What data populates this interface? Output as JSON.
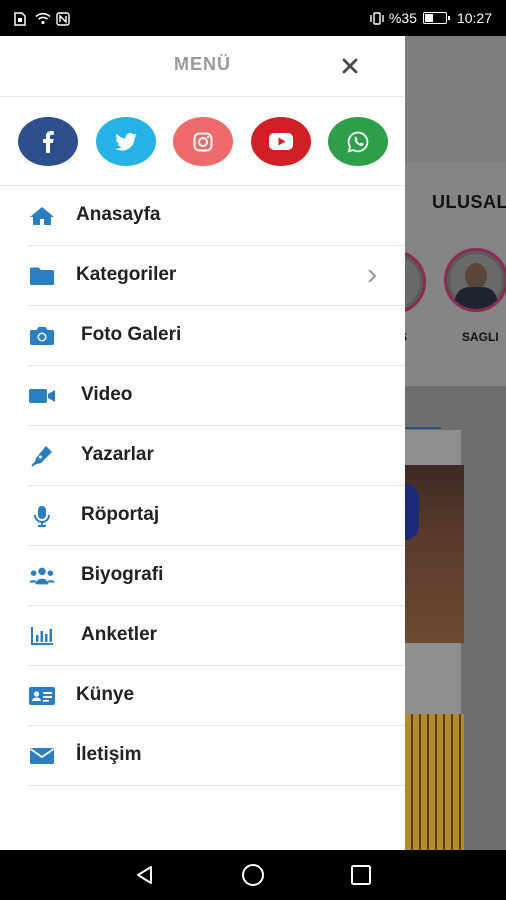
{
  "status": {
    "battery_percent": "%35",
    "time": "10:27",
    "battery_level": 0.35
  },
  "background": {
    "tab_label": "ULUSAL",
    "stories": [
      {
        "label": "S"
      },
      {
        "label": "SAGLI"
      }
    ]
  },
  "drawer": {
    "title": "MENÜ",
    "social": [
      {
        "icon": "facebook-icon",
        "color": "#2d4f8b"
      },
      {
        "icon": "twitter-icon",
        "color": "#27b2e6"
      },
      {
        "icon": "instagram-icon",
        "color": "#ef6a6a"
      },
      {
        "icon": "youtube-icon",
        "color": "#d11f26"
      },
      {
        "icon": "whatsapp-icon",
        "color": "#2f9e4a"
      }
    ],
    "items": [
      {
        "label": "Anasayfa",
        "icon": "home-icon"
      },
      {
        "label": "Kategoriler",
        "icon": "folder-icon"
      },
      {
        "label": "Foto Galeri",
        "icon": "camera-icon"
      },
      {
        "label": "Video",
        "icon": "video-camera-icon"
      },
      {
        "label": "Yazarlar",
        "icon": "pen-icon"
      },
      {
        "label": "Röportaj",
        "icon": "microphone-icon"
      },
      {
        "label": "Biyografi",
        "icon": "users-icon"
      },
      {
        "label": "Anketler",
        "icon": "poll-chart-icon"
      },
      {
        "label": "Künye",
        "icon": "id-card-icon"
      },
      {
        "label": "İletişim",
        "icon": "envelope-icon"
      }
    ]
  },
  "colors": {
    "accent": "#2a7fc1",
    "title_gray": "#9a9a9a"
  }
}
